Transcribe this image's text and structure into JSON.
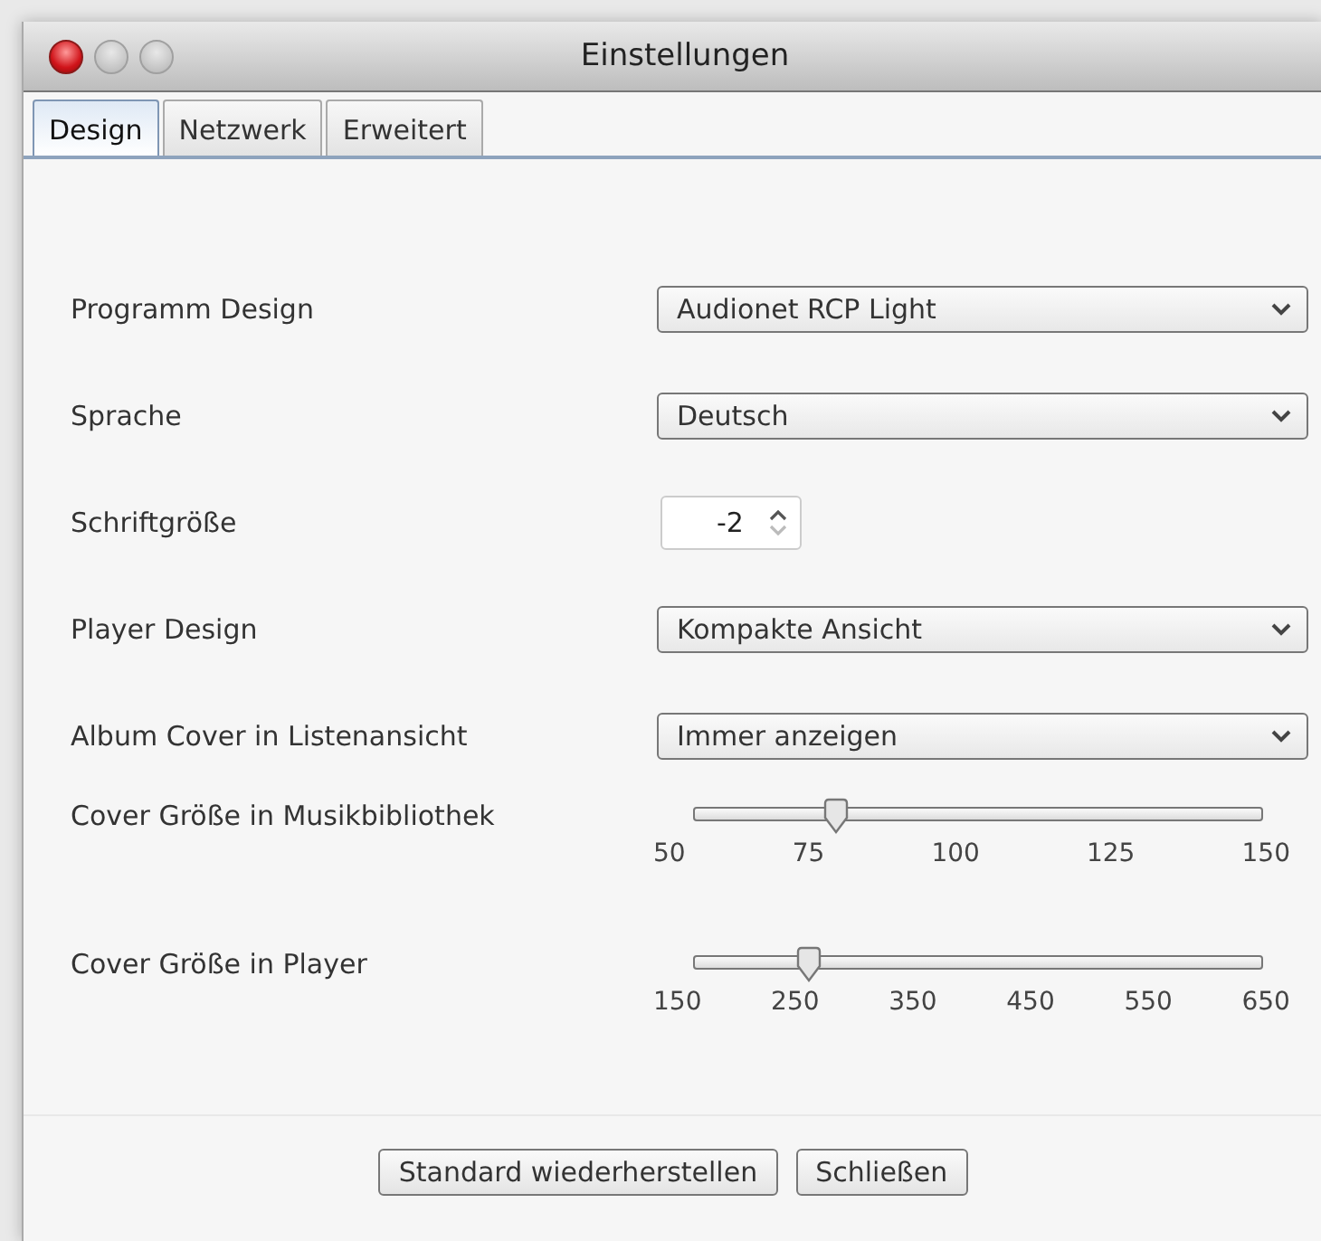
{
  "window": {
    "title": "Einstellungen"
  },
  "tabs": [
    {
      "label": "Design",
      "selected": true
    },
    {
      "label": "Netzwerk",
      "selected": false
    },
    {
      "label": "Erweitert",
      "selected": false
    }
  ],
  "settings": [
    {
      "kind": "select",
      "label": "Programm Design",
      "value": "Audionet RCP Light"
    },
    {
      "kind": "select",
      "label": "Sprache",
      "value": "Deutsch"
    },
    {
      "kind": "spinner",
      "label": "Schriftgröße",
      "value": "-2"
    },
    {
      "kind": "select",
      "label": "Player Design",
      "value": "Kompakte Ansicht"
    },
    {
      "kind": "select",
      "label": "Album Cover in Listenansicht",
      "value": "Immer anzeigen"
    },
    {
      "kind": "slider",
      "label": "Cover Größe in Musikbibliothek",
      "level": 0.25,
      "ticks": [
        "50",
        "75",
        "100",
        "125",
        "150"
      ]
    },
    {
      "kind": "slider",
      "label": "Cover Größe in Player",
      "level": 0.2,
      "ticks": [
        "150",
        "250",
        "350",
        "450",
        "550",
        "650"
      ]
    }
  ],
  "buttons": [
    "Standard wiederherstellen",
    "Schließen"
  ]
}
